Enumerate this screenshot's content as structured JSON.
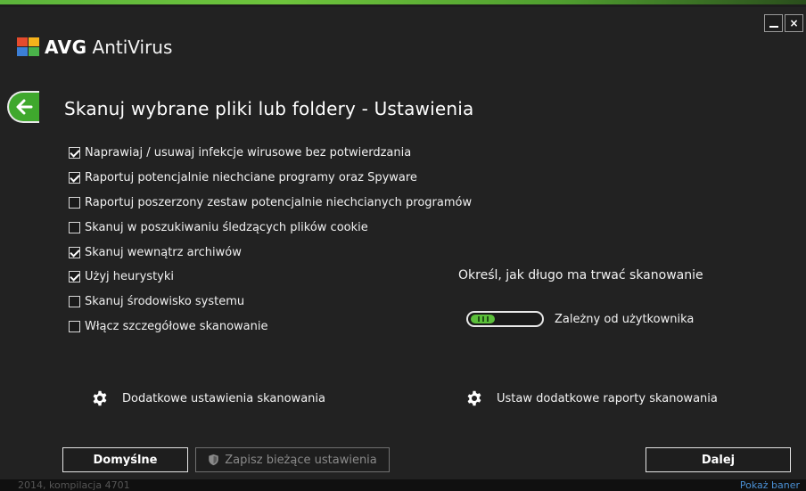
{
  "app": {
    "brand": "AVG",
    "product": "AntiVirus"
  },
  "window_controls": {
    "minimize": "_",
    "close": "×"
  },
  "page": {
    "title": "Skanuj wybrane pliki lub foldery - Ustawienia"
  },
  "options": [
    {
      "label": "Naprawiaj / usuwaj infekcje wirusowe bez potwierdzania",
      "checked": true
    },
    {
      "label": "Raportuj potencjalnie niechciane programy oraz Spyware",
      "checked": true
    },
    {
      "label": "Raportuj poszerzony zestaw potencjalnie niechcianych programów",
      "checked": false
    },
    {
      "label": "Skanuj w poszukiwaniu śledzących plików cookie",
      "checked": false
    },
    {
      "label": "Skanuj wewnątrz archiwów",
      "checked": true
    },
    {
      "label": "Użyj heurystyki",
      "checked": true
    },
    {
      "label": "Skanuj środowisko systemu",
      "checked": false
    },
    {
      "label": "Włącz szczegółowe skanowanie",
      "checked": false
    }
  ],
  "duration": {
    "title": "Określ, jak długo ma trwać skanowanie",
    "value_label": "Zależny od użytkownika",
    "level_fraction": 0.35
  },
  "advanced": {
    "scan_settings": "Dodatkowe ustawienia skanowania",
    "report_settings": "Ustaw dodatkowe raporty skanowania"
  },
  "buttons": {
    "default": "Domyślne",
    "save": "Zapisz bieżące ustawienia",
    "next": "Dalej"
  },
  "footer": {
    "version": "2014, kompilacja 4701",
    "banner_link": "Pokaż baner"
  },
  "colors": {
    "accent_green": "#3fa82d",
    "background": "#222222",
    "link_blue": "#4a8fd4"
  }
}
